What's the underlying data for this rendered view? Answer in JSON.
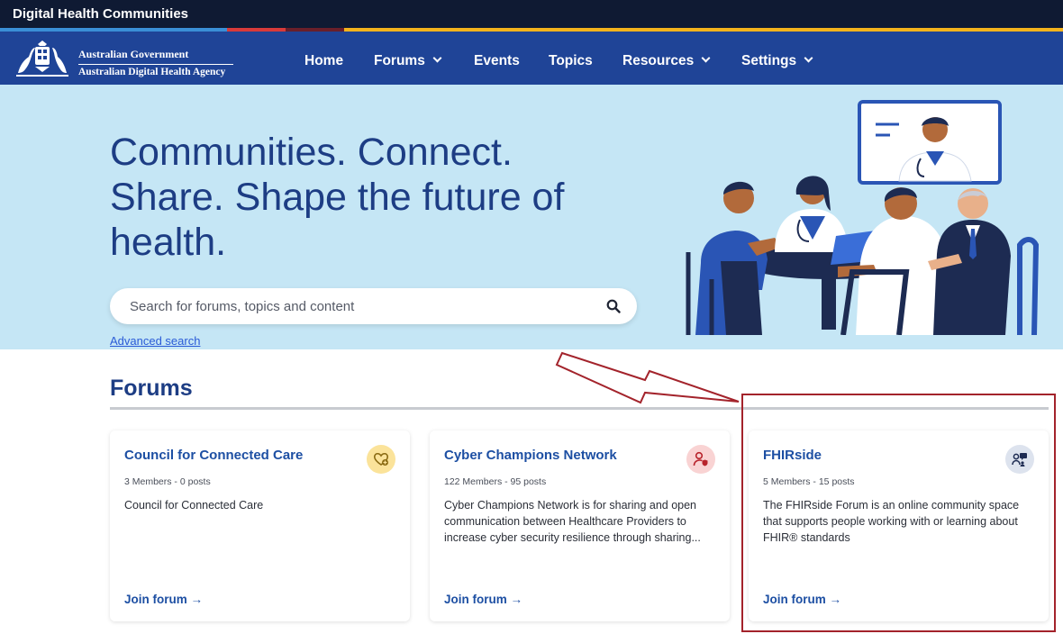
{
  "site": {
    "title": "Digital Health Communities"
  },
  "colors": {
    "strip": "#0f1a33",
    "nav": "#1f4497",
    "hero": "#c5e6f5",
    "accent_bar": [
      "#3a8fd6",
      "#d83a3a",
      "#6a1f2a",
      "#f3b31c"
    ],
    "highlight": "#a3232b"
  },
  "logo": {
    "line1": "Australian Government",
    "line2": "Australian Digital Health Agency"
  },
  "nav": [
    {
      "label": "Home",
      "dropdown": false
    },
    {
      "label": "Forums",
      "dropdown": true
    },
    {
      "label": "Events",
      "dropdown": false
    },
    {
      "label": "Topics",
      "dropdown": false
    },
    {
      "label": "Resources",
      "dropdown": true
    },
    {
      "label": "Settings",
      "dropdown": true
    }
  ],
  "hero": {
    "headline": "Communities. Connect. Share. Shape the future of health.",
    "search_placeholder": "Search for forums, topics and content",
    "advanced_search": "Advanced search"
  },
  "forums": {
    "heading": "Forums",
    "cards": [
      {
        "title": "Council for Connected Care",
        "meta": "3 Members - 0 posts",
        "desc": "Council for Connected Care",
        "join": "Join forum →",
        "icon": "heart-plus-icon",
        "badge_color": "#fbe39a"
      },
      {
        "title": "Cyber Champions Network",
        "meta": "122 Members - 95 posts",
        "desc": "Cyber Champions Network is for sharing and open communication between Healthcare Providers to increase cyber security resilience through sharing...",
        "join": "Join forum →",
        "icon": "user-shield-icon",
        "badge_color": "#f9d3d3"
      },
      {
        "title": "FHIRside",
        "meta": "5 Members - 15 posts",
        "desc": "The FHIRside Forum is an online community space that supports people working with or learning about FHIR® standards",
        "join": "Join forum →",
        "icon": "people-chat-icon",
        "badge_color": "#dde3ee"
      }
    ]
  }
}
